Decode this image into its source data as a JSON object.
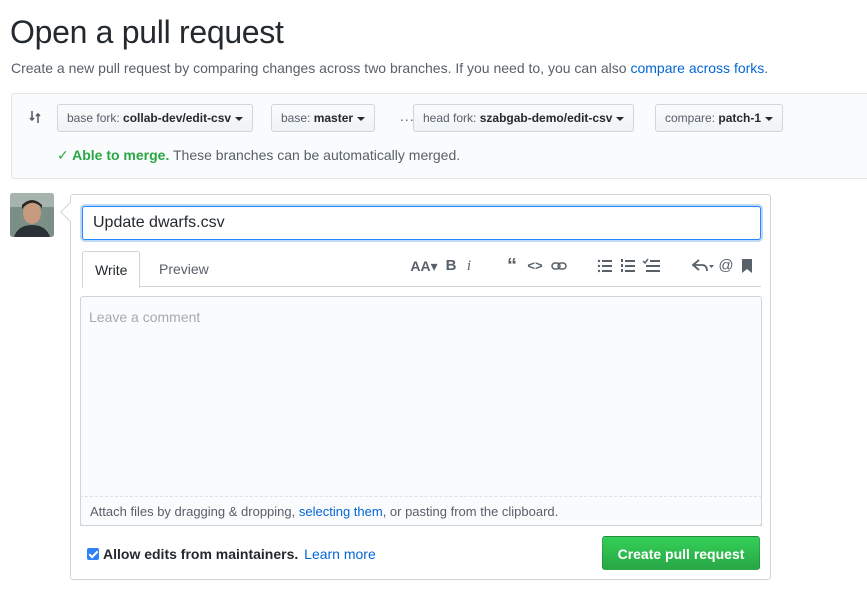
{
  "header": {
    "title": "Open a pull request",
    "subtitle_text": "Create a new pull request by comparing changes across two branches. If you need to, you can also ",
    "subtitle_link": "compare across forks",
    "subtitle_end": "."
  },
  "range": {
    "base_fork": {
      "label": "base fork:",
      "value": "collab-dev/edit-csv"
    },
    "base": {
      "label": "base:",
      "value": "master"
    },
    "separator": "...",
    "head_fork": {
      "label": "head fork:",
      "value": "szabgab-demo/edit-csv"
    },
    "compare": {
      "label": "compare:",
      "value": "patch-1"
    },
    "merge_ok": "✓ Able to merge.",
    "merge_text": " These branches can be automatically merged."
  },
  "form": {
    "title_value": "Update dwarfs.csv",
    "tabs": [
      {
        "label": "Write"
      },
      {
        "label": "Preview"
      }
    ],
    "toolbar_icons": [
      "text-size-icon",
      "bold-icon",
      "italic-icon",
      "quote-icon",
      "code-icon",
      "link-icon",
      "unordered-list-icon",
      "ordered-list-icon",
      "task-list-icon",
      "reply-icon",
      "mention-icon",
      "bookmark-icon"
    ],
    "comment_placeholder": "Leave a comment",
    "attach_text_1": "Attach files by dragging & dropping, ",
    "attach_link": "selecting them",
    "attach_text_2": ", or pasting from the clipboard.",
    "allow_edits_label": "Allow edits from maintainers.",
    "learn_more": "Learn more",
    "create_button": "Create pull request",
    "allow_edits_checked": true
  },
  "colors": {
    "accent": "#0366d6",
    "success": "#28a745",
    "border": "#d1d5da"
  }
}
